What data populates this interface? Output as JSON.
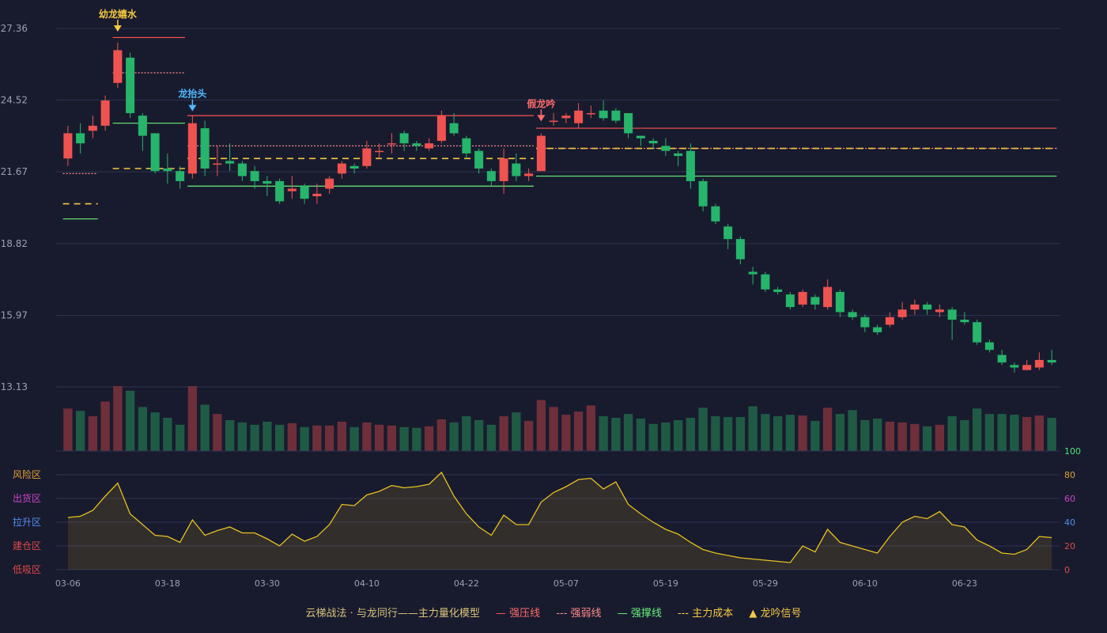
{
  "chart_data": {
    "type": "candlestick",
    "price_axis": {
      "min": 13.13,
      "max": 27.36,
      "ticks": [
        "27.36",
        "24.52",
        "21.67",
        "18.82",
        "15.97",
        "13.13"
      ]
    },
    "x_ticks": [
      {
        "label": "03-06",
        "i": 0
      },
      {
        "label": "03-18",
        "i": 8
      },
      {
        "label": "03-30",
        "i": 16
      },
      {
        "label": "04-10",
        "i": 24
      },
      {
        "label": "04-22",
        "i": 32
      },
      {
        "label": "05-07",
        "i": 40
      },
      {
        "label": "05-19",
        "i": 48
      },
      {
        "label": "05-29",
        "i": 56
      },
      {
        "label": "06-10",
        "i": 64
      },
      {
        "label": "06-23",
        "i": 72
      }
    ],
    "candles": [
      [
        22.2,
        23.2,
        23.5,
        21.9
      ],
      [
        23.2,
        22.8,
        23.6,
        22.4
      ],
      [
        23.3,
        23.5,
        23.9,
        23.0
      ],
      [
        23.5,
        24.5,
        24.7,
        23.3
      ],
      [
        25.2,
        26.5,
        26.8,
        25.0
      ],
      [
        26.2,
        24.0,
        26.4,
        23.8
      ],
      [
        23.9,
        23.1,
        24.0,
        22.5
      ],
      [
        23.2,
        21.7,
        23.2,
        21.6
      ],
      [
        21.8,
        21.7,
        22.4,
        21.2
      ],
      [
        21.7,
        21.3,
        21.9,
        21.0
      ],
      [
        21.6,
        23.6,
        23.9,
        21.4
      ],
      [
        23.4,
        21.8,
        23.7,
        21.5
      ],
      [
        22.0,
        22.0,
        22.7,
        21.5
      ],
      [
        22.1,
        22.0,
        22.8,
        21.7
      ],
      [
        22.0,
        21.5,
        22.1,
        21.3
      ],
      [
        21.7,
        21.3,
        21.9,
        21.0
      ],
      [
        21.3,
        21.2,
        21.5,
        20.7
      ],
      [
        21.3,
        20.5,
        21.4,
        20.4
      ],
      [
        20.9,
        21.0,
        21.5,
        20.6
      ],
      [
        21.1,
        20.6,
        21.2,
        20.4
      ],
      [
        20.7,
        20.8,
        21.2,
        20.4
      ],
      [
        21.0,
        21.4,
        21.5,
        20.8
      ],
      [
        21.6,
        22.0,
        22.1,
        21.4
      ],
      [
        21.9,
        21.8,
        22.0,
        21.6
      ],
      [
        21.9,
        22.6,
        22.9,
        21.8
      ],
      [
        22.5,
        22.5,
        22.8,
        22.2
      ],
      [
        22.8,
        22.8,
        23.2,
        22.4
      ],
      [
        23.2,
        22.8,
        23.3,
        22.5
      ],
      [
        22.8,
        22.7,
        22.9,
        22.5
      ],
      [
        22.6,
        22.8,
        23.0,
        22.5
      ],
      [
        22.9,
        23.9,
        24.1,
        22.8
      ],
      [
        23.6,
        23.2,
        24.0,
        23.1
      ],
      [
        23.0,
        22.4,
        23.1,
        22.2
      ],
      [
        22.5,
        21.8,
        22.6,
        21.6
      ],
      [
        21.7,
        21.3,
        21.8,
        21.1
      ],
      [
        21.3,
        22.2,
        22.6,
        20.8
      ],
      [
        22.0,
        21.5,
        22.4,
        21.3
      ],
      [
        21.5,
        21.6,
        21.8,
        21.3
      ],
      [
        21.7,
        23.1,
        23.2,
        21.7
      ],
      [
        23.7,
        23.7,
        24.0,
        23.5
      ],
      [
        23.8,
        23.9,
        24.0,
        23.6
      ],
      [
        23.6,
        24.1,
        24.4,
        23.4
      ],
      [
        24.0,
        24.0,
        24.3,
        23.8
      ],
      [
        24.1,
        23.8,
        24.5,
        23.7
      ],
      [
        24.1,
        23.7,
        24.2,
        23.6
      ],
      [
        24.0,
        23.2,
        24.0,
        23.0
      ],
      [
        23.1,
        23.0,
        23.1,
        22.7
      ],
      [
        22.9,
        22.8,
        23.0,
        22.6
      ],
      [
        22.7,
        22.5,
        23.0,
        22.3
      ],
      [
        22.4,
        22.3,
        22.5,
        21.9
      ],
      [
        22.5,
        21.3,
        22.8,
        21.0
      ],
      [
        21.3,
        20.3,
        21.4,
        20.1
      ],
      [
        20.3,
        19.7,
        20.4,
        19.6
      ],
      [
        19.5,
        19.0,
        19.6,
        18.6
      ],
      [
        19.0,
        18.2,
        19.1,
        18.0
      ],
      [
        17.7,
        17.6,
        17.9,
        17.2
      ],
      [
        17.6,
        17.0,
        17.7,
        16.9
      ],
      [
        17.0,
        16.9,
        17.1,
        16.8
      ],
      [
        16.8,
        16.3,
        16.9,
        16.2
      ],
      [
        16.4,
        16.9,
        17.0,
        16.3
      ],
      [
        16.7,
        16.4,
        16.8,
        16.2
      ],
      [
        16.3,
        17.1,
        17.4,
        16.2
      ],
      [
        16.9,
        16.1,
        17.0,
        15.9
      ],
      [
        16.1,
        15.9,
        16.2,
        15.8
      ],
      [
        15.9,
        15.5,
        16.0,
        15.3
      ],
      [
        15.5,
        15.3,
        15.6,
        15.2
      ],
      [
        15.6,
        15.9,
        16.1,
        15.5
      ],
      [
        15.9,
        16.2,
        16.5,
        15.8
      ],
      [
        16.2,
        16.4,
        16.6,
        16.0
      ],
      [
        16.4,
        16.2,
        16.5,
        16.0
      ],
      [
        16.1,
        16.2,
        16.4,
        15.9
      ],
      [
        16.2,
        15.8,
        16.3,
        15.0
      ],
      [
        15.8,
        15.7,
        16.1,
        15.6
      ],
      [
        15.7,
        14.9,
        15.8,
        14.8
      ],
      [
        14.9,
        14.6,
        15.0,
        14.5
      ],
      [
        14.4,
        14.1,
        14.6,
        14.0
      ],
      [
        14.0,
        13.9,
        14.1,
        13.7
      ],
      [
        13.8,
        14.0,
        14.2,
        13.8
      ],
      [
        13.9,
        14.2,
        14.5,
        13.8
      ],
      [
        14.2,
        14.1,
        14.6,
        14.0
      ]
    ],
    "volume": [
      55,
      52,
      45,
      64,
      84,
      78,
      57,
      50,
      43,
      34,
      84,
      60,
      48,
      40,
      37,
      34,
      38,
      34,
      36,
      31,
      33,
      33,
      38,
      31,
      37,
      34,
      33,
      31,
      30,
      32,
      41,
      37,
      45,
      40,
      34,
      45,
      50,
      39,
      66,
      57,
      47,
      51,
      59,
      45,
      43,
      48,
      42,
      35,
      37,
      40,
      43,
      56,
      45,
      44,
      44,
      58,
      48,
      45,
      47,
      46,
      39,
      56,
      48,
      53,
      40,
      42,
      38,
      37,
      35,
      32,
      34,
      45,
      40,
      55,
      48,
      48,
      47,
      44,
      46,
      43
    ],
    "oscillator": {
      "axis": [
        0,
        100
      ],
      "ticks": [
        0,
        20,
        40,
        60,
        80,
        100
      ],
      "values": [
        44,
        45,
        50,
        62,
        73,
        47,
        38,
        29,
        28,
        23,
        42,
        29,
        33,
        36,
        31,
        31,
        26,
        20,
        30,
        24,
        28,
        38,
        55,
        54,
        63,
        66,
        71,
        69,
        70,
        72,
        82,
        62,
        47,
        36,
        29,
        46,
        38,
        38,
        57,
        65,
        70,
        76,
        77,
        68,
        74,
        55,
        47,
        40,
        34,
        30,
        23,
        17,
        14,
        12,
        10,
        9,
        8,
        7,
        6,
        20,
        15,
        34,
        23,
        20,
        17,
        14,
        28,
        40,
        45,
        43,
        49,
        38,
        36,
        25,
        20,
        14,
        13,
        17,
        28,
        27
      ]
    },
    "zones": [
      "风险区",
      "出货区",
      "拉升区",
      "建仓区",
      "低吸区"
    ],
    "annotations": [
      {
        "text": "幼龙嬉水",
        "i": 4,
        "price": 27.36,
        "type": "down",
        "color": "#f5c842"
      },
      {
        "text": "龙抬头",
        "i": 10,
        "price": 24.2,
        "type": "down",
        "color": "#4fb8ff"
      },
      {
        "text": "假龙吟",
        "i": 38,
        "price": 23.8,
        "type": "down",
        "color": "#ff6b6b"
      }
    ],
    "levels": [
      {
        "kind": "strong_pressure",
        "from": 4,
        "to": 9,
        "value": 27.0
      },
      {
        "kind": "strong_pressure",
        "from": 10,
        "to": 37,
        "value": 23.9
      },
      {
        "kind": "strong_pressure",
        "from": 38,
        "to": 79,
        "value": 23.4
      },
      {
        "kind": "weak_pressure",
        "from": 0,
        "to": 2,
        "value": 21.6
      },
      {
        "kind": "weak_pressure",
        "from": 4,
        "to": 9,
        "value": 25.6
      },
      {
        "kind": "weak_pressure",
        "from": 10,
        "to": 37,
        "value": 22.7
      },
      {
        "kind": "weak_pressure",
        "from": 38,
        "to": 79,
        "value": 22.6
      },
      {
        "kind": "support",
        "from": 0,
        "to": 2,
        "value": 19.8
      },
      {
        "kind": "support",
        "from": 4,
        "to": 9,
        "value": 23.6
      },
      {
        "kind": "support",
        "from": 10,
        "to": 37,
        "value": 21.1
      },
      {
        "kind": "support",
        "from": 38,
        "to": 79,
        "value": 21.5
      },
      {
        "kind": "main_cost",
        "from": 0,
        "to": 2,
        "value": 20.4
      },
      {
        "kind": "main_cost",
        "from": 4,
        "to": 9,
        "value": 21.8
      },
      {
        "kind": "main_cost",
        "from": 10,
        "to": 37,
        "value": 22.2
      },
      {
        "kind": "main_cost",
        "from": 38,
        "to": 79,
        "value": 22.6
      }
    ],
    "colors": {
      "up": "#ef5350",
      "down": "#26b56b",
      "support": "#69f07a",
      "pressure": "#ff5252",
      "weak": "#ff8a8a",
      "cost": "#f5c842",
      "osc": "#e8c020"
    }
  },
  "legend": {
    "title": "云梯战法 · 与龙同行——主力量化模型",
    "strong_pressure": "强压线",
    "weak_pressure": "强弱线",
    "support": "强撑线",
    "main_cost": "主力成本",
    "signal": "龙吟信号"
  }
}
